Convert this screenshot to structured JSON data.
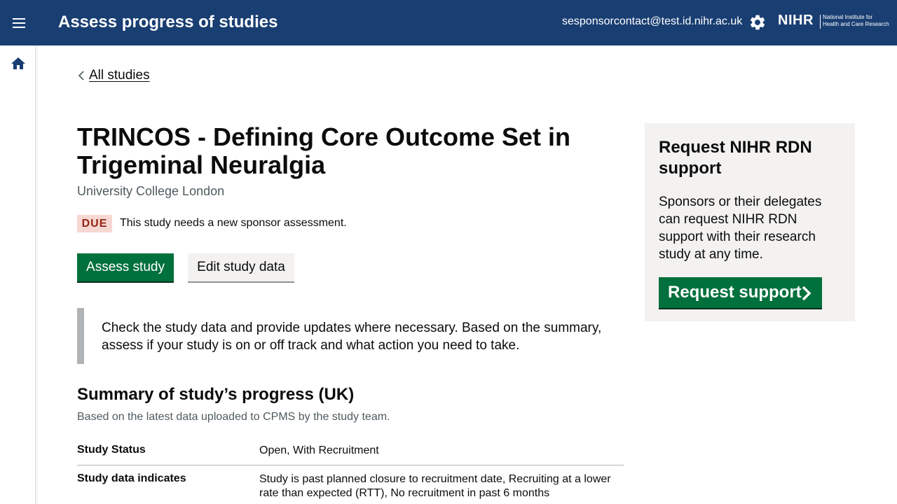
{
  "header": {
    "title": "Assess progress of studies",
    "user_email": "sesponsorcontact@test.id.nihr.ac.uk",
    "logo": {
      "wordmark": "NIHR",
      "line1": "National Institute for",
      "line2": "Health and Care Research"
    },
    "icons": {
      "menu": "menu-icon",
      "settings": "gear-icon"
    }
  },
  "sidebar": {
    "home_icon": "home-icon"
  },
  "breadcrumb": {
    "back_label": "All studies"
  },
  "study": {
    "title": "TRINCOS - Defining Core Outcome Set in Trigeminal Neuralgia",
    "organisation": "University College London",
    "status_tag": "DUE",
    "status_message": "This study needs a new sponsor assessment."
  },
  "actions": {
    "assess_label": "Assess study",
    "edit_label": "Edit study data"
  },
  "inset": {
    "text": "Check the study data and provide updates where necessary. Based on the summary, assess if your study is on or off track and what action you need to take."
  },
  "summary": {
    "heading": "Summary of study’s progress (UK)",
    "subheading": "Based on the latest data uploaded to CPMS by the study team.",
    "rows": [
      {
        "key": "Study Status",
        "value": "Open, With Recruitment"
      },
      {
        "key": "Study data indicates",
        "value": "Study is past planned closure to recruitment date, Recruiting at a lower rate than expected (RTT), No recruitment in past 6 months"
      }
    ]
  },
  "aside": {
    "heading": "Request NIHR RDN support",
    "body": "Sponsors or their delegates can request NIHR RDN support with their research study at any time.",
    "button_label": "Request support"
  },
  "colors": {
    "header_bg": "#193e72",
    "primary_button": "#00703c",
    "due_tag_bg": "#f6d7d2",
    "due_tag_text": "#942514",
    "aside_bg": "#f3f2f1"
  }
}
